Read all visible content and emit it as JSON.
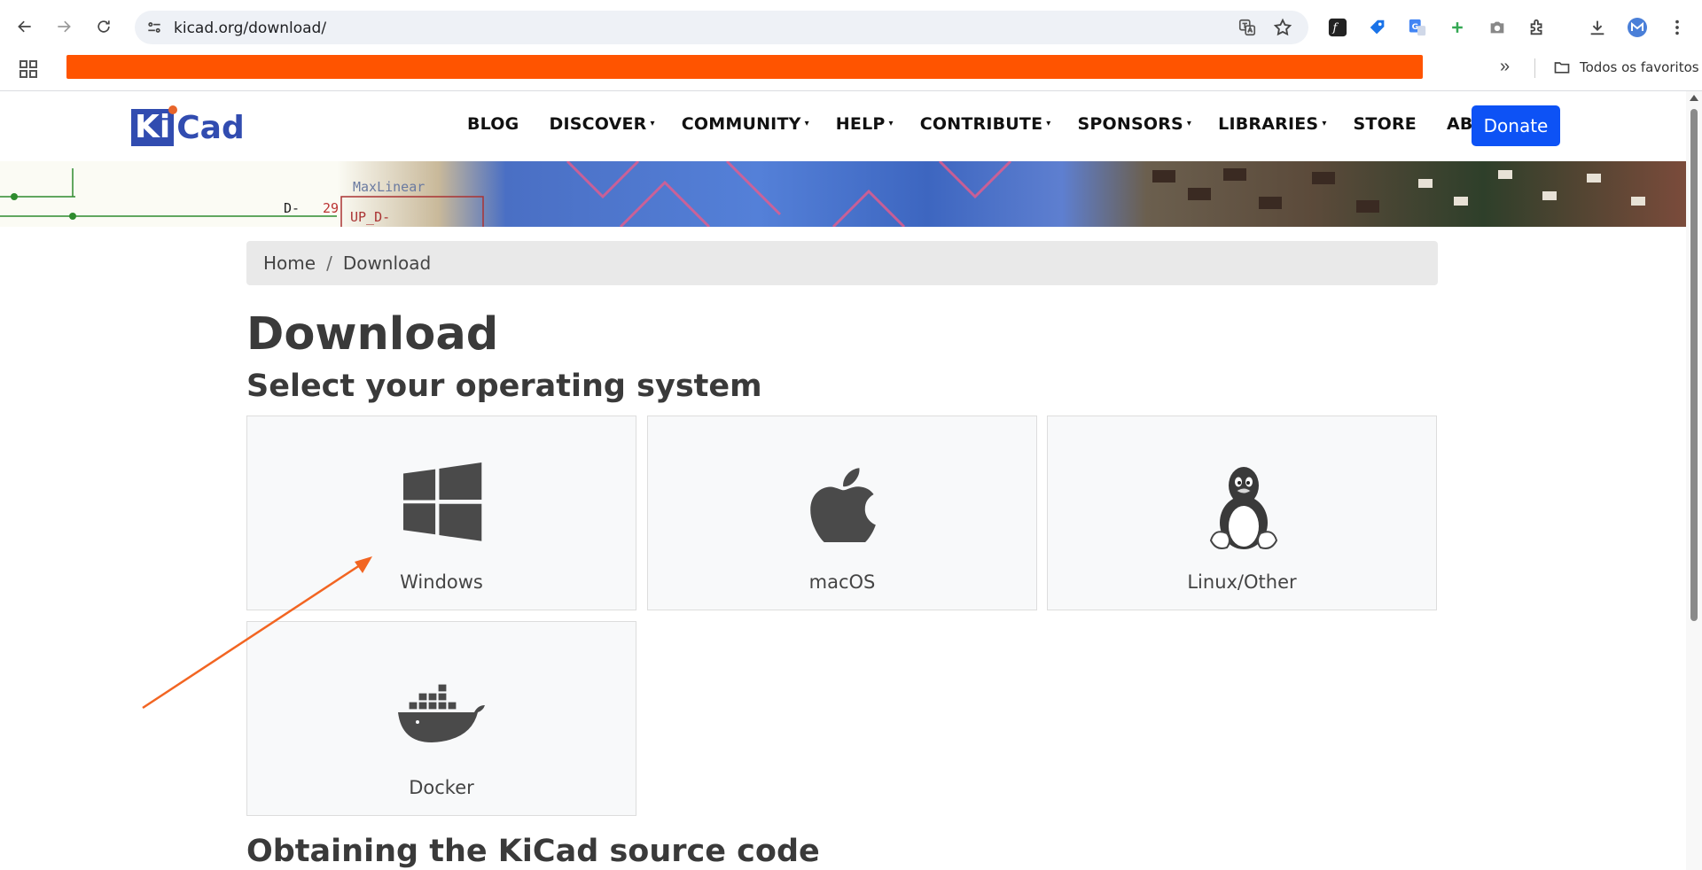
{
  "browser": {
    "url": "kicad.org/download/",
    "all_bookmarks_label": "Todos os favoritos",
    "more_bookmarks_label": "»"
  },
  "navbar": {
    "logo_ki": "Ki",
    "logo_cad": "Cad",
    "menu": [
      {
        "label": "BLOG",
        "caret": ""
      },
      {
        "label": "DISCOVER",
        "caret": "▾"
      },
      {
        "label": "COMMUNITY",
        "caret": "▾"
      },
      {
        "label": "HELP",
        "caret": "▾"
      },
      {
        "label": "CONTRIBUTE",
        "caret": "▾"
      },
      {
        "label": "SPONSORS",
        "caret": "▾"
      },
      {
        "label": "LIBRARIES",
        "caret": "▾"
      },
      {
        "label": "STORE",
        "caret": ""
      },
      {
        "label": "ABOUT",
        "caret": "▾"
      }
    ],
    "donate_label": "Donate"
  },
  "banner": {
    "text_maxlinear": "MaxLinear",
    "text_d": "D-",
    "text_29": "29",
    "text_upd": "UP_D-"
  },
  "breadcrumb": {
    "home": "Home",
    "separator": "/",
    "current": "Download"
  },
  "main": {
    "title": "Download",
    "subtitle": "Select your operating system",
    "os_options": [
      {
        "label": "Windows",
        "icon": "windows-icon"
      },
      {
        "label": "macOS",
        "icon": "apple-icon"
      },
      {
        "label": "Linux/Other",
        "icon": "linux-tux-icon"
      },
      {
        "label": "Docker",
        "icon": "docker-icon"
      }
    ],
    "source_heading": "Obtaining the KiCad source code"
  },
  "colors": {
    "accent_orange": "#ff5400",
    "donate_blue": "#0d52f5",
    "kicad_blue": "#314cb0",
    "annotation_arrow": "#f26522"
  }
}
